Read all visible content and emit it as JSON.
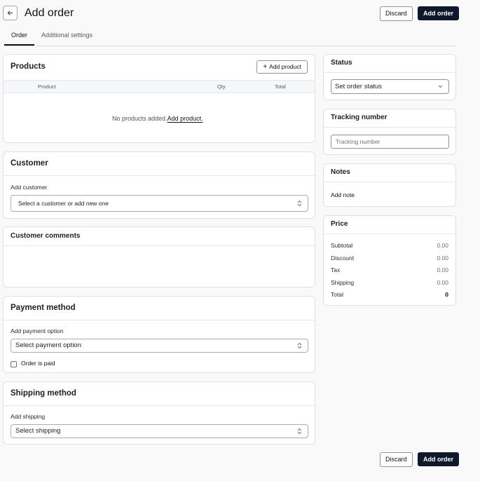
{
  "header": {
    "title": "Add order",
    "discard_label": "Discard",
    "add_order_label": "Add order"
  },
  "tabs": [
    {
      "label": "Order",
      "active": true
    },
    {
      "label": "Additional settings",
      "active": false
    }
  ],
  "products": {
    "title": "Products",
    "add_button": "Add product",
    "columns": [
      "Product",
      "Qty",
      "Total"
    ],
    "empty_text": "No products added.",
    "empty_link": "Add product."
  },
  "customer": {
    "title": "Customer",
    "field_label": "Add customer",
    "placeholder": "Select a customer or add new one"
  },
  "comments": {
    "title": "Customer comments"
  },
  "payment": {
    "title": "Payment method",
    "field_label": "Add payment option",
    "placeholder": "Select payment option",
    "paid_label": "Order is paid",
    "paid_checked": false
  },
  "shipping": {
    "title": "Shipping method",
    "field_label": "Add shipping",
    "placeholder": "Select shipping"
  },
  "status": {
    "title": "Status",
    "placeholder": "Set order status"
  },
  "tracking": {
    "title": "Tracking number",
    "placeholder": "Tracking number"
  },
  "notes": {
    "title": "Notes",
    "add_note": "Add note"
  },
  "price": {
    "title": "Price",
    "rows": [
      {
        "label": "Subtotal",
        "value": "0.00"
      },
      {
        "label": "Discount",
        "value": "0.00"
      },
      {
        "label": "Tax",
        "value": "0.00"
      },
      {
        "label": "Shipping",
        "value": "0.00"
      },
      {
        "label": "Total",
        "value": "0"
      }
    ]
  },
  "footer": {
    "discard_label": "Discard",
    "add_order_label": "Add order"
  },
  "icons": {
    "back": "arrow-left-icon",
    "plus": "plus-icon",
    "chevron": "chevron-down-icon",
    "updown": "chevron-up-down-icon"
  }
}
